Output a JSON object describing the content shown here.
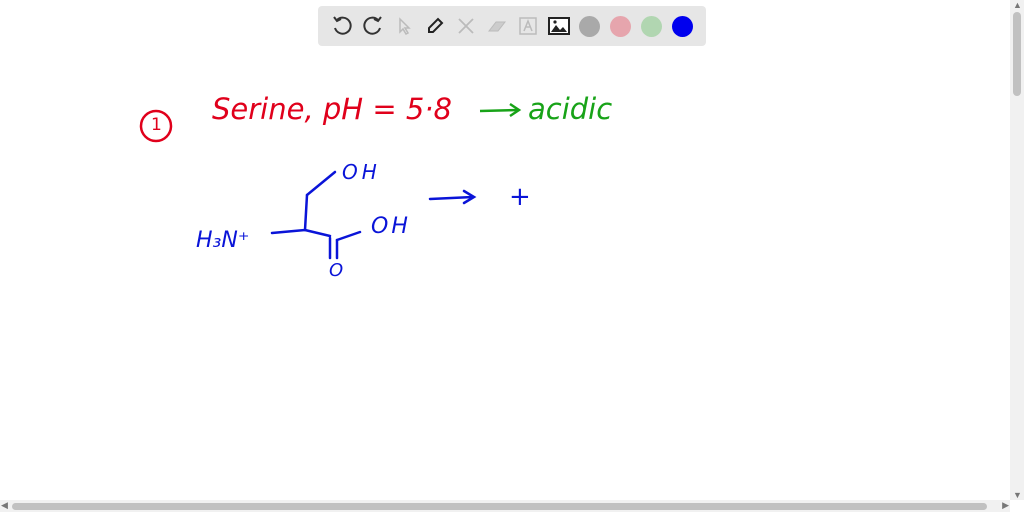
{
  "toolbar": {
    "tools": [
      "undo-icon",
      "redo-icon",
      "select-icon",
      "pen-icon",
      "tools-icon",
      "eraser-icon",
      "text-icon",
      "image-icon"
    ],
    "colors": [
      "#a9a9a9",
      "#e6a5ad",
      "#b1d6b1",
      "#0000ee"
    ]
  },
  "canvas": {
    "number": "1",
    "title": "Serine, pH = 5·8",
    "result": "acidic",
    "nh3": "H₃N⁺",
    "oh_top": "OH",
    "oh_right": "OH",
    "carbonyl_o": "O",
    "plus": "+",
    "colors": {
      "red": "#e0001b",
      "green": "#18a318",
      "blue": "#0a14d8"
    }
  }
}
